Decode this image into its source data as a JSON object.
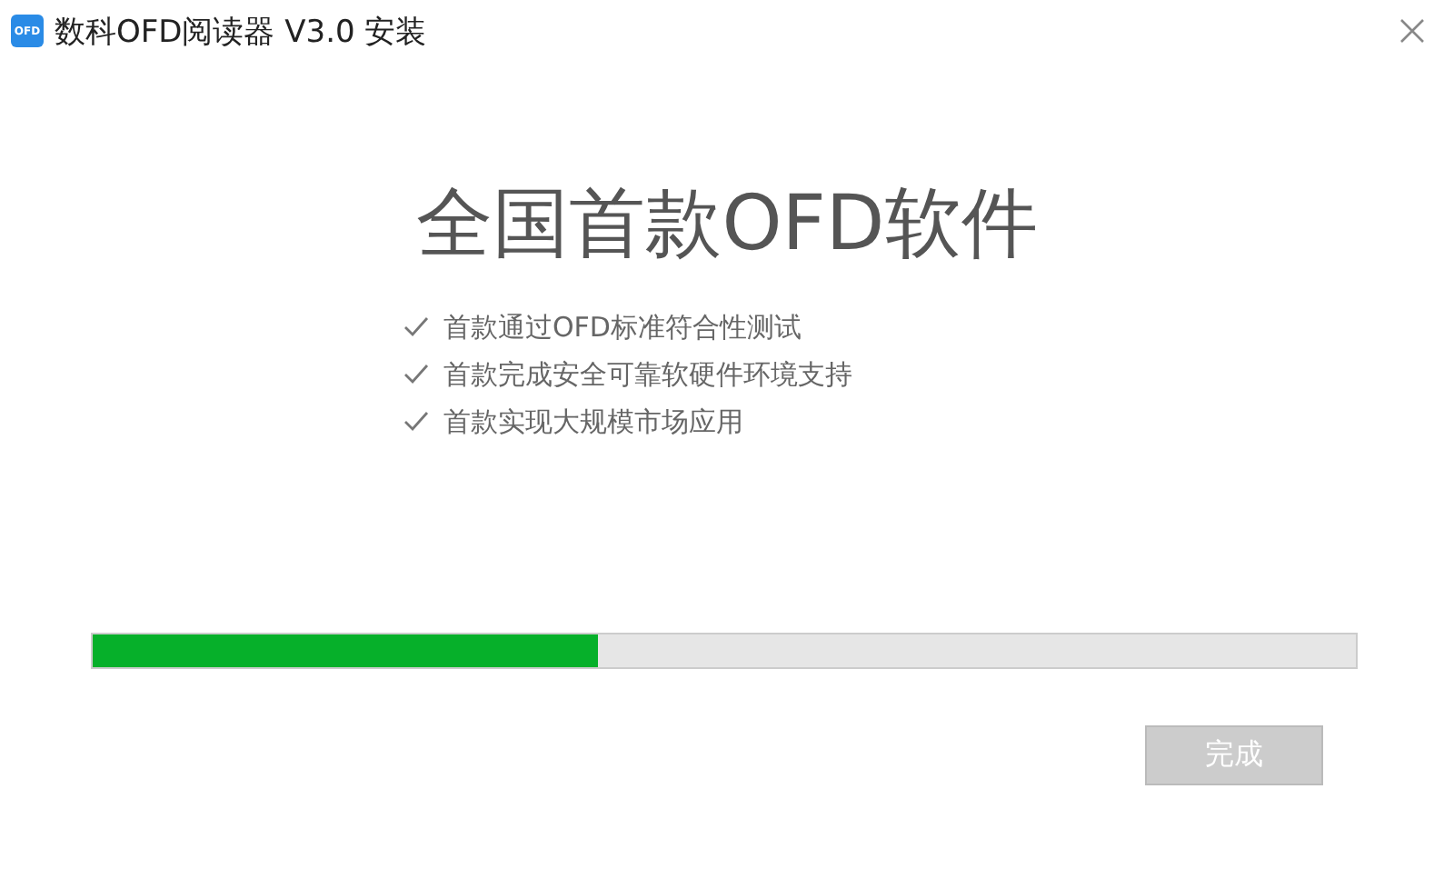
{
  "window": {
    "logo_text": "OFD",
    "title": "数科OFD阅读器 V3.0 安装"
  },
  "headline": "全国首款OFD软件",
  "features": [
    {
      "text": "首款通过OFD标准符合性测试",
      "checked": true
    },
    {
      "text": "首款完成安全可靠软硬件环境支持",
      "checked": true
    },
    {
      "text": "首款实现大规模市场应用",
      "checked": true
    }
  ],
  "progress": {
    "level": 0.4
  },
  "finish_button": {
    "label": "完成",
    "disabled": true
  }
}
